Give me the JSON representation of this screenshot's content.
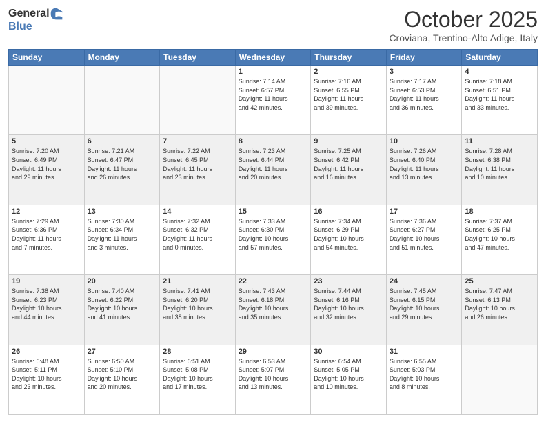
{
  "header": {
    "logo": {
      "general": "General",
      "blue": "Blue"
    },
    "title": "October 2025",
    "location": "Croviana, Trentino-Alto Adige, Italy"
  },
  "calendar": {
    "headers": [
      "Sunday",
      "Monday",
      "Tuesday",
      "Wednesday",
      "Thursday",
      "Friday",
      "Saturday"
    ],
    "rows": [
      [
        {
          "day": "",
          "info": ""
        },
        {
          "day": "",
          "info": ""
        },
        {
          "day": "",
          "info": ""
        },
        {
          "day": "1",
          "info": "Sunrise: 7:14 AM\nSunset: 6:57 PM\nDaylight: 11 hours\nand 42 minutes."
        },
        {
          "day": "2",
          "info": "Sunrise: 7:16 AM\nSunset: 6:55 PM\nDaylight: 11 hours\nand 39 minutes."
        },
        {
          "day": "3",
          "info": "Sunrise: 7:17 AM\nSunset: 6:53 PM\nDaylight: 11 hours\nand 36 minutes."
        },
        {
          "day": "4",
          "info": "Sunrise: 7:18 AM\nSunset: 6:51 PM\nDaylight: 11 hours\nand 33 minutes."
        }
      ],
      [
        {
          "day": "5",
          "info": "Sunrise: 7:20 AM\nSunset: 6:49 PM\nDaylight: 11 hours\nand 29 minutes."
        },
        {
          "day": "6",
          "info": "Sunrise: 7:21 AM\nSunset: 6:47 PM\nDaylight: 11 hours\nand 26 minutes."
        },
        {
          "day": "7",
          "info": "Sunrise: 7:22 AM\nSunset: 6:45 PM\nDaylight: 11 hours\nand 23 minutes."
        },
        {
          "day": "8",
          "info": "Sunrise: 7:23 AM\nSunset: 6:44 PM\nDaylight: 11 hours\nand 20 minutes."
        },
        {
          "day": "9",
          "info": "Sunrise: 7:25 AM\nSunset: 6:42 PM\nDaylight: 11 hours\nand 16 minutes."
        },
        {
          "day": "10",
          "info": "Sunrise: 7:26 AM\nSunset: 6:40 PM\nDaylight: 11 hours\nand 13 minutes."
        },
        {
          "day": "11",
          "info": "Sunrise: 7:28 AM\nSunset: 6:38 PM\nDaylight: 11 hours\nand 10 minutes."
        }
      ],
      [
        {
          "day": "12",
          "info": "Sunrise: 7:29 AM\nSunset: 6:36 PM\nDaylight: 11 hours\nand 7 minutes."
        },
        {
          "day": "13",
          "info": "Sunrise: 7:30 AM\nSunset: 6:34 PM\nDaylight: 11 hours\nand 3 minutes."
        },
        {
          "day": "14",
          "info": "Sunrise: 7:32 AM\nSunset: 6:32 PM\nDaylight: 11 hours\nand 0 minutes."
        },
        {
          "day": "15",
          "info": "Sunrise: 7:33 AM\nSunset: 6:30 PM\nDaylight: 10 hours\nand 57 minutes."
        },
        {
          "day": "16",
          "info": "Sunrise: 7:34 AM\nSunset: 6:29 PM\nDaylight: 10 hours\nand 54 minutes."
        },
        {
          "day": "17",
          "info": "Sunrise: 7:36 AM\nSunset: 6:27 PM\nDaylight: 10 hours\nand 51 minutes."
        },
        {
          "day": "18",
          "info": "Sunrise: 7:37 AM\nSunset: 6:25 PM\nDaylight: 10 hours\nand 47 minutes."
        }
      ],
      [
        {
          "day": "19",
          "info": "Sunrise: 7:38 AM\nSunset: 6:23 PM\nDaylight: 10 hours\nand 44 minutes."
        },
        {
          "day": "20",
          "info": "Sunrise: 7:40 AM\nSunset: 6:22 PM\nDaylight: 10 hours\nand 41 minutes."
        },
        {
          "day": "21",
          "info": "Sunrise: 7:41 AM\nSunset: 6:20 PM\nDaylight: 10 hours\nand 38 minutes."
        },
        {
          "day": "22",
          "info": "Sunrise: 7:43 AM\nSunset: 6:18 PM\nDaylight: 10 hours\nand 35 minutes."
        },
        {
          "day": "23",
          "info": "Sunrise: 7:44 AM\nSunset: 6:16 PM\nDaylight: 10 hours\nand 32 minutes."
        },
        {
          "day": "24",
          "info": "Sunrise: 7:45 AM\nSunset: 6:15 PM\nDaylight: 10 hours\nand 29 minutes."
        },
        {
          "day": "25",
          "info": "Sunrise: 7:47 AM\nSunset: 6:13 PM\nDaylight: 10 hours\nand 26 minutes."
        }
      ],
      [
        {
          "day": "26",
          "info": "Sunrise: 6:48 AM\nSunset: 5:11 PM\nDaylight: 10 hours\nand 23 minutes."
        },
        {
          "day": "27",
          "info": "Sunrise: 6:50 AM\nSunset: 5:10 PM\nDaylight: 10 hours\nand 20 minutes."
        },
        {
          "day": "28",
          "info": "Sunrise: 6:51 AM\nSunset: 5:08 PM\nDaylight: 10 hours\nand 17 minutes."
        },
        {
          "day": "29",
          "info": "Sunrise: 6:53 AM\nSunset: 5:07 PM\nDaylight: 10 hours\nand 13 minutes."
        },
        {
          "day": "30",
          "info": "Sunrise: 6:54 AM\nSunset: 5:05 PM\nDaylight: 10 hours\nand 10 minutes."
        },
        {
          "day": "31",
          "info": "Sunrise: 6:55 AM\nSunset: 5:03 PM\nDaylight: 10 hours\nand 8 minutes."
        },
        {
          "day": "",
          "info": ""
        }
      ]
    ]
  }
}
